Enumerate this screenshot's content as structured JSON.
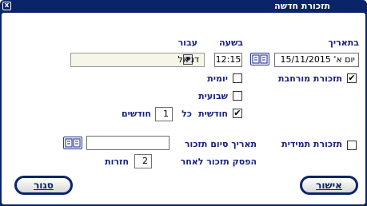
{
  "window": {
    "title": "תזכורת חדשה",
    "close_glyph": "x"
  },
  "labels": {
    "date": "בתאריך",
    "time": "בשעה",
    "for": "עבור",
    "extended_reminder": "תזכורת מורחבת",
    "daily": "יומית",
    "weekly": "שבועית",
    "monthly": "חודשית",
    "every": "כל",
    "months": "חודשים",
    "permanent_reminder": "תזכורת תמידית",
    "end_date": "תאריך סיום תזכור",
    "stop_after": "הפסק תזכור לאחר",
    "repetitions": "חזרות"
  },
  "fields": {
    "date": "יום א' 15/11/2015",
    "time": "12:15",
    "for_selected": "דניאל",
    "every_months": "1",
    "end_date": "",
    "stop_after": "2"
  },
  "checks": {
    "extended_reminder": "✔",
    "daily": "",
    "weekly": "",
    "monthly": "✔",
    "permanent_reminder": ""
  },
  "buttons": {
    "ok": "אישור",
    "close": "סגור"
  },
  "icons": [
    "book-icon",
    "dropdown-arrow-icon",
    "checkmark-icon",
    "close-icon"
  ]
}
